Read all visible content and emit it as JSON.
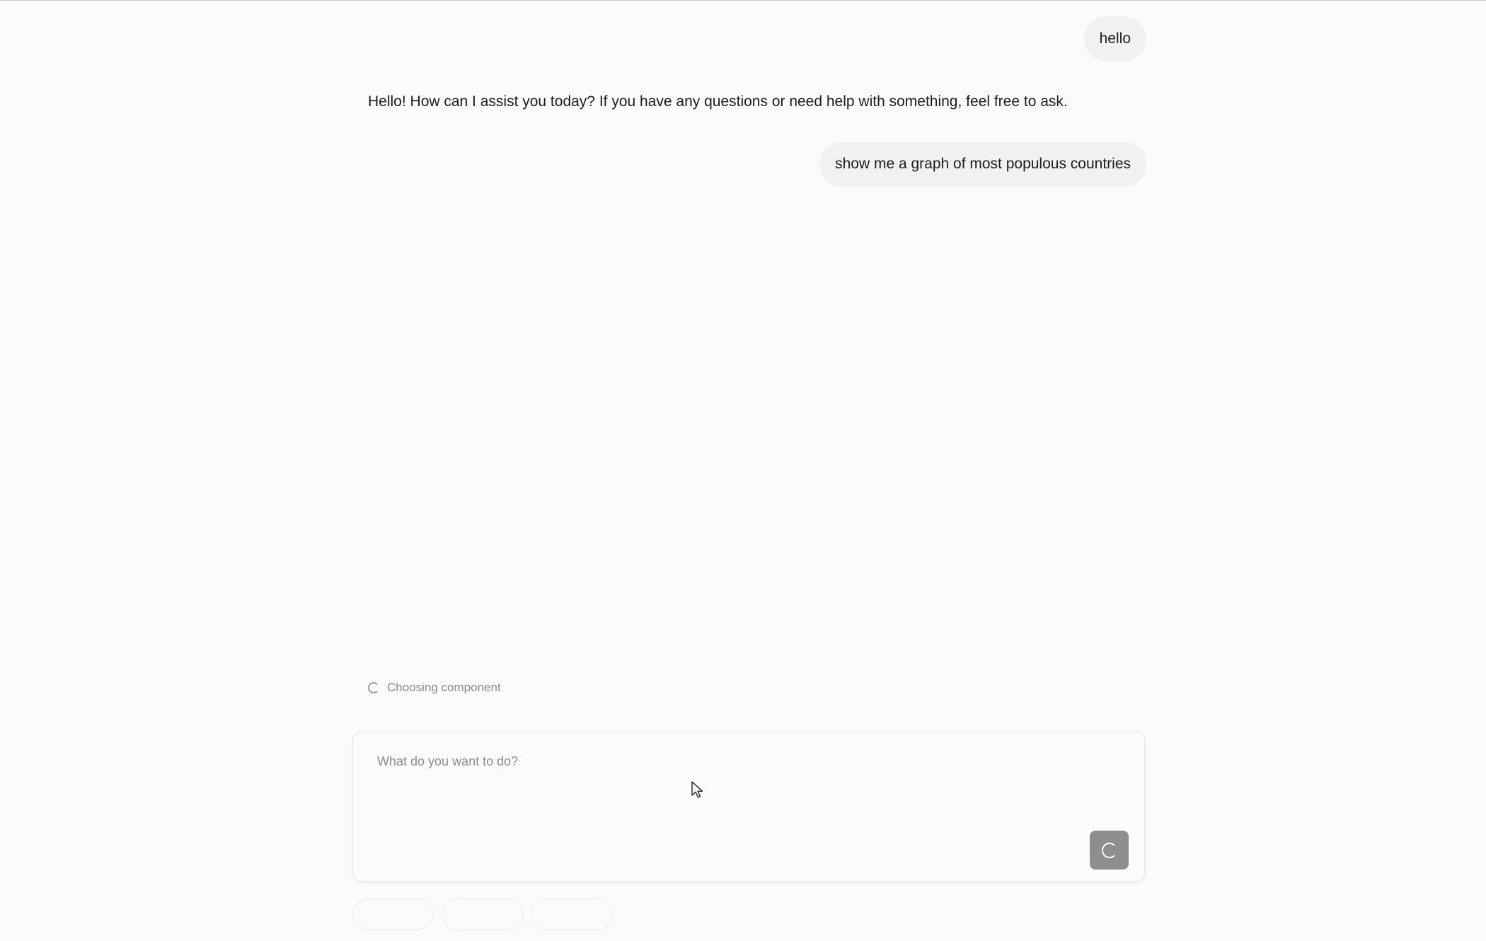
{
  "conversation": {
    "messages": [
      {
        "role": "user",
        "text": "hello"
      },
      {
        "role": "assistant",
        "text": "Hello! How can I assist you today? If you have any questions or need help with something, feel free to ask."
      },
      {
        "role": "user",
        "text": "show me a graph of most populous countries"
      }
    ]
  },
  "status": {
    "text": "Choosing component",
    "icon": "loading-spinner-icon"
  },
  "composer": {
    "placeholder": "What do you want to do?",
    "value": "",
    "send_button_icon": "loading-spinner-icon"
  },
  "suggestions": {
    "pills": [
      "",
      "",
      ""
    ]
  },
  "colors": {
    "background": "#fbfbfa",
    "user_bubble": "#f1f1f0",
    "send_button": "#8e8e8e",
    "status_text": "#8a8a8a"
  }
}
